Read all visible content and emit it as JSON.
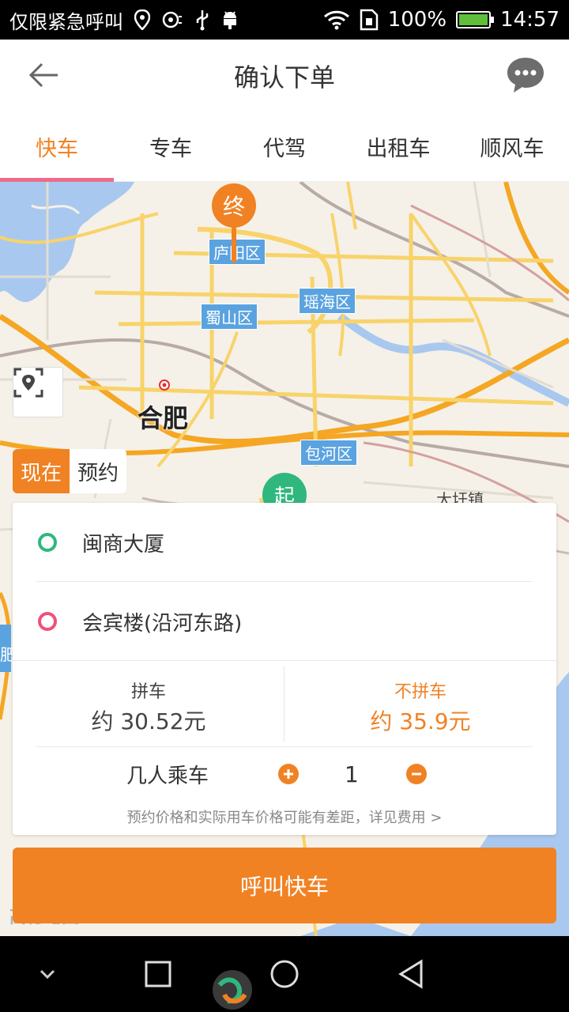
{
  "status_bar": {
    "carrier": "仅限紧急呼叫",
    "battery": "100%",
    "time": "14:57",
    "battery_level": 1.0,
    "icons": [
      "location-icon",
      "sync-icon",
      "usb-icon",
      "android-icon",
      "wifi-icon",
      "sim-icon",
      "battery-icon"
    ]
  },
  "header": {
    "title": "确认下单",
    "back_icon": "arrow-left-icon",
    "chat_icon": "chat-bubble-icon"
  },
  "tabs": [
    {
      "label": "快车",
      "active": true
    },
    {
      "label": "专车",
      "active": false
    },
    {
      "label": "代驾",
      "active": false
    },
    {
      "label": "出租车",
      "active": false
    },
    {
      "label": "顺风车",
      "active": false
    }
  ],
  "map": {
    "end_pin": "终",
    "start_pin": "起",
    "city": "合肥",
    "districts": [
      "庐阳区",
      "瑶海区",
      "蜀山区",
      "包河区"
    ],
    "town": "大圩镇",
    "edge_label": "肥",
    "logo": "高德地图"
  },
  "time_toggle": {
    "now": "现在",
    "reserve": "预约"
  },
  "order": {
    "origin": "闽商大厦",
    "destination": "会宾楼(沿河东路)",
    "carpool": {
      "label": "拼车",
      "price": "约 30.52元"
    },
    "no_carpool": {
      "label": "不拼车",
      "price": "约 35.9元"
    },
    "passengers_label": "几人乘车",
    "passenger_count": "1",
    "note": "预约价格和实际用车价格可能有差距，详见费用 >"
  },
  "call_button": "呼叫快车",
  "colors": {
    "accent": "#f08224",
    "start_green": "#2fb77d",
    "end_pink": "#f0507a",
    "tab_indicator": "#f06b8a",
    "district_blue": "#5aa3e0"
  }
}
